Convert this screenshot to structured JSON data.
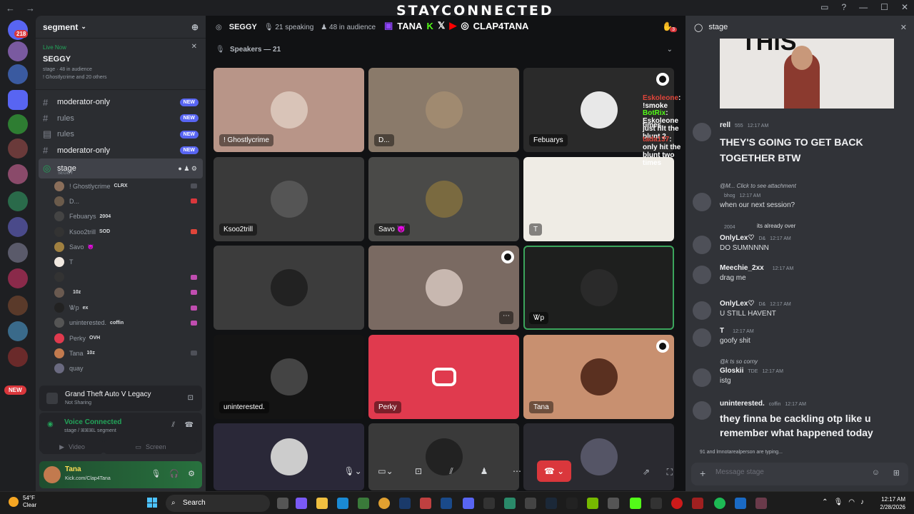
{
  "window": {
    "title": "STAYCONNECTED",
    "back": "←",
    "fwd": "→"
  },
  "guild": {
    "name": "segment",
    "add_icon": "+"
  },
  "live": {
    "label": "Live Now",
    "title": "SEGGY",
    "meta": "stage · 48 in audience",
    "meta2": "! Ghostlycrime and 20 others"
  },
  "channels": [
    {
      "name": "moderator-only",
      "badge": "NEW",
      "bold": true
    },
    {
      "name": "rules",
      "badge": "NEW",
      "bold": false
    },
    {
      "name": "rules",
      "badge": "NEW",
      "bold": false
    },
    {
      "name": "moderator-only",
      "badge": "NEW",
      "bold": true
    }
  ],
  "stage_channel": {
    "name": "stage",
    "sub": "SEGGY"
  },
  "voice_members": [
    {
      "name": "! Ghostlycrime",
      "tag": "CLRX",
      "color": "#8a6e5a"
    },
    {
      "name": "D...",
      "tag": "",
      "color": "#6b5b4b"
    },
    {
      "name": "Febuarys",
      "tag": "2004",
      "color": "#444"
    },
    {
      "name": "Ksoo2trill",
      "tag": "SOD",
      "color": "#333"
    },
    {
      "name": "Savo",
      "tag": "😈",
      "color": "#a08040"
    },
    {
      "name": "T",
      "tag": "",
      "color": "#f0e8e0"
    },
    {
      "name": "",
      "tag": "",
      "color": "#333"
    },
    {
      "name": "",
      "tag": "10z",
      "color": "#6a5a50"
    },
    {
      "name": "Ꮤp",
      "tag": "ex",
      "color": "#222"
    },
    {
      "name": "uninterested.",
      "tag": "coffin",
      "color": "#555"
    },
    {
      "name": "Perky",
      "tag": "OVH",
      "color": "#e03a4e"
    },
    {
      "name": "Tana",
      "tag": "10z",
      "color": "#c27a4e"
    },
    {
      "name": "quay",
      "tag": "",
      "color": "#6a6a80"
    }
  ],
  "game": {
    "title": "Grand Theft Auto V Legacy",
    "sub": "Not Sharing"
  },
  "voice": {
    "status": "Voice Connected",
    "sub": "stage / ꕤꕤꕤL segment",
    "video": "Video",
    "screen": "Screen"
  },
  "user": {
    "name": "Tana",
    "status": "Kick.com/Clap4Tana"
  },
  "stage_header": {
    "title": "SEGGY",
    "speaking": "21 speaking",
    "audience": "48 in audience",
    "hand_count": "3"
  },
  "stream_overlay": {
    "tw": "TANA",
    "handle": "CLAP4TANA"
  },
  "speakers_label": "Speakers — 21",
  "tiles": [
    {
      "name": "! Ghostlycrime",
      "bg": "#b89588",
      "pic": "#d9c4b8",
      "mod": false
    },
    {
      "name": "D...",
      "bg": "#8a7a6a",
      "pic": "#a08a70",
      "mod": false
    },
    {
      "name": "Febuarys",
      "bg": "#2a2a2a",
      "pic": "#e8e8e8",
      "mod": true
    },
    {
      "name": "Ksoo2trill",
      "bg": "#3a3a3a",
      "pic": "#555",
      "mod": false
    },
    {
      "name": "Savo 😈",
      "bg": "#4a4a48",
      "pic": "#7a6a40",
      "mod": false
    },
    {
      "name": "T",
      "bg": "#efece5",
      "pic": "#efece5",
      "mod": false
    },
    {
      "name": "",
      "bg": "#3c3c3c",
      "pic": "#222",
      "mod": false
    },
    {
      "name": "",
      "bg": "#7a6a62",
      "pic": "#c8b8b0",
      "mod": true
    },
    {
      "name": "Ꮤp",
      "bg": "#1e1f1e",
      "pic": "#2a2a2a",
      "mod": false
    },
    {
      "name": "uninterested.",
      "bg": "#141414",
      "pic": "#444",
      "mod": false
    },
    {
      "name": "Perky",
      "bg": "#e03a4e",
      "pic": "#e03a4e",
      "mod": false
    },
    {
      "name": "Tana",
      "bg": "#c89070",
      "pic": "#5a3020",
      "mod": true
    },
    {
      "name": "",
      "bg": "#2a2838",
      "pic": "#ccc",
      "mod": false
    },
    {
      "name": "",
      "bg": "#3a3a3a",
      "pic": "#222",
      "mod": false
    },
    {
      "name": "",
      "bg": "#2a2a30",
      "pic": "#556",
      "mod": false
    }
  ],
  "overlay_chat": [
    {
      "user": "Eskoleone",
      "text": ": !smoke",
      "color": "#e0453a"
    },
    {
      "user": "BotRix",
      "text": ": Eskoleone just hit the blunt 2",
      "color": "#53fc18"
    },
    {
      "user": "",
      "text": "times.",
      "color": "#fff"
    },
    {
      "user": "tada137",
      "text": ": only hit the blunt two times",
      "color": "#e0453a"
    }
  ],
  "chat_panel": {
    "title": "stage",
    "cam_text": "THIS",
    "overlay_msg": "THEY'S GOING TO GET BACK TOGETHER BTW",
    "messages": [
      {
        "reply": "",
        "user": "rell",
        "tag": "555",
        "time": "12:17 AM",
        "text": ""
      },
      {
        "reply": "@M... Click to see attachment",
        "user": "",
        "tag": "bhog",
        "time": "12:17 AM",
        "text": "when our next session?"
      },
      {
        "reply": "",
        "user": "",
        "tag": "2004",
        "time": "",
        "text": "its already over"
      },
      {
        "reply": "",
        "user": "OnlyLex♡",
        "tag": "D&",
        "time": "12:17 AM",
        "text": "DO SUMNNNN"
      },
      {
        "reply": "",
        "user": "Meechie_2xx",
        "tag": "",
        "time": "12:17 AM",
        "text": "drag me"
      },
      {
        "reply": "",
        "user": "OnlyLex♡",
        "tag": "D&",
        "time": "12:17 AM",
        "text": "U STILL HAVENT"
      },
      {
        "reply": "",
        "user": "T",
        "tag": "",
        "time": "12:17 AM",
        "text": "goofy shit"
      },
      {
        "reply": "@k ts so corny",
        "user": "Gloskii",
        "tag": "TDE",
        "time": "12:17 AM",
        "text": "istg"
      },
      {
        "reply": "",
        "user": "uninterested.",
        "tag": "coffin",
        "time": "12:17 AM",
        "text": "they finna be cackling otp like u remember what happened today"
      }
    ],
    "typing": "91 and lmnotarealperson are typing...",
    "input_placeholder": "Message stage"
  },
  "taskbar": {
    "temp": "54°F",
    "cond": "Clear",
    "search": "Search",
    "time": "12:17 AM",
    "date": "2/28/2026"
  }
}
